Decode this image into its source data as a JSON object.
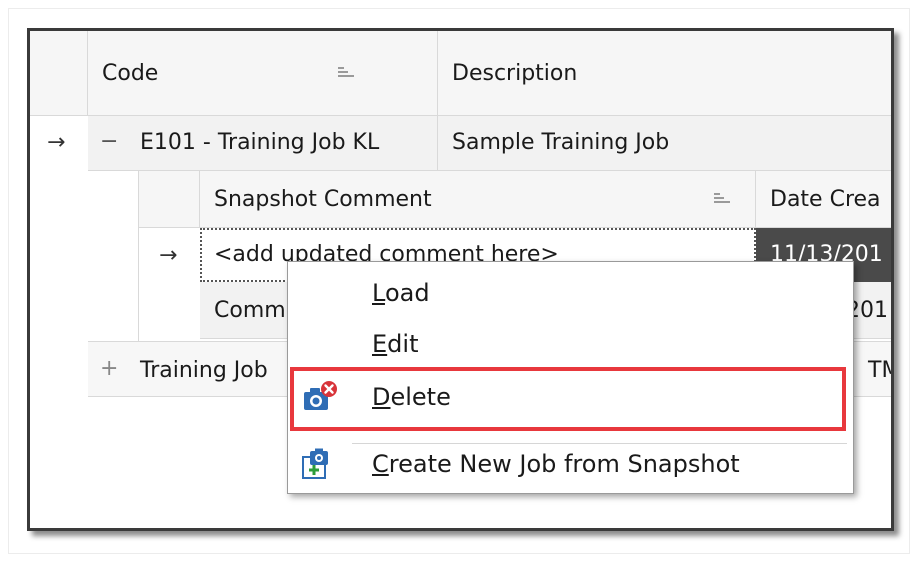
{
  "grid": {
    "columns": [
      {
        "label": "Code"
      },
      {
        "label": "Description"
      }
    ],
    "rows": [
      {
        "indicator": "→",
        "expander": "−",
        "code": "E101 - Training Job KL",
        "description": "Sample Training Job"
      },
      {
        "expander": "+",
        "code": "Training Job",
        "description": "TM"
      }
    ]
  },
  "detail": {
    "columns": [
      {
        "label": "Snapshot Comment"
      },
      {
        "label": "Date Crea"
      }
    ],
    "rows": [
      {
        "indicator": "→",
        "comment": "<add updated comment here>",
        "date": "11/13/201"
      },
      {
        "comment": "Comm",
        "date": "201"
      }
    ]
  },
  "context_menu": {
    "items": [
      {
        "mnemonic": "L",
        "rest": "oad",
        "icon": null
      },
      {
        "mnemonic": "E",
        "rest": "dit",
        "icon": null
      },
      {
        "mnemonic": "D",
        "rest": "elete",
        "icon": "camera-delete-icon",
        "highlighted": true
      },
      {
        "mnemonic": "C",
        "rest": "reate New Job from Snapshot",
        "icon": "create-job-from-snapshot-icon"
      }
    ],
    "highlight_color": "#e8383d"
  }
}
